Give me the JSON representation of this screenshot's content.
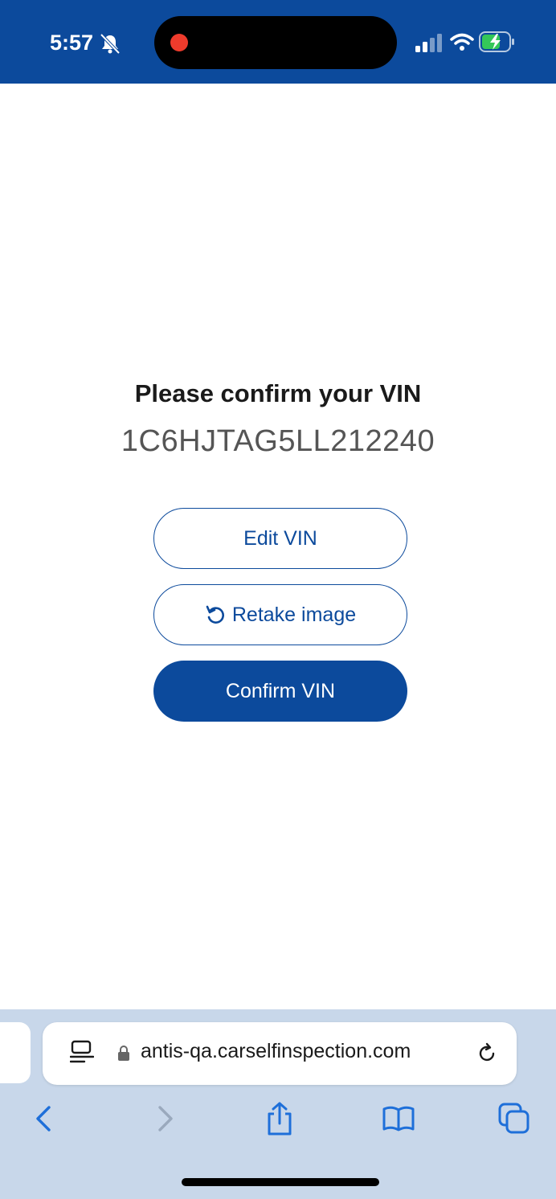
{
  "status_bar": {
    "time": "5:57",
    "icons": [
      "bell-slash-icon",
      "signal-icon",
      "wifi-icon",
      "battery-charging-icon"
    ]
  },
  "main": {
    "title": "Please confirm your VIN",
    "vin": "1C6HJTAG5LL212240",
    "buttons": {
      "edit_label": "Edit VIN",
      "retake_label": "Retake image",
      "confirm_label": "Confirm VIN"
    }
  },
  "browser": {
    "url": "antis-qa.carselfinspection.com",
    "icons": [
      "reader-icon",
      "lock-icon",
      "reload-icon",
      "back-icon",
      "forward-icon",
      "share-icon",
      "bookmarks-icon",
      "tabs-icon"
    ]
  },
  "colors": {
    "brand": "#0c4a9c",
    "browser_bg": "#c8d7ea",
    "record_dot": "#ef3b2c"
  }
}
